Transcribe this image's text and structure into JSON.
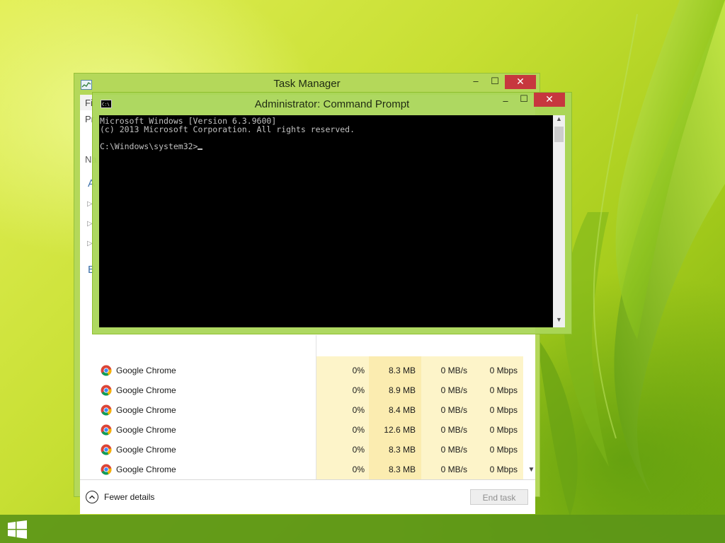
{
  "colors": {
    "accent": "#b4d85a",
    "close_button": "#c7373e",
    "console_bg": "#000000",
    "console_text": "#c0c0c0",
    "taskbar": "#5c9618",
    "column_highlight": "#fdf4c9"
  },
  "taskbar": {
    "start_icon": "windows-logo-icon"
  },
  "task_manager": {
    "title": "Task Manager",
    "icon": "task-manager-icon",
    "menu_peek": "Fi",
    "tab_peek": "Pr",
    "header_peek": "Na",
    "group_peek_apps": "A",
    "group_peek_background": "B",
    "processes": [
      {
        "name": "Google Chrome",
        "cpu": "0%",
        "memory": "8.3 MB",
        "disk": "0 MB/s",
        "network": "0 Mbps"
      },
      {
        "name": "Google Chrome",
        "cpu": "0%",
        "memory": "8.9 MB",
        "disk": "0 MB/s",
        "network": "0 Mbps"
      },
      {
        "name": "Google Chrome",
        "cpu": "0%",
        "memory": "8.4 MB",
        "disk": "0 MB/s",
        "network": "0 Mbps"
      },
      {
        "name": "Google Chrome",
        "cpu": "0%",
        "memory": "12.6 MB",
        "disk": "0 MB/s",
        "network": "0 Mbps"
      },
      {
        "name": "Google Chrome",
        "cpu": "0%",
        "memory": "8.3 MB",
        "disk": "0 MB/s",
        "network": "0 Mbps"
      },
      {
        "name": "Google Chrome",
        "cpu": "0%",
        "memory": "8.3 MB",
        "disk": "0 MB/s",
        "network": "0 Mbps"
      }
    ],
    "fewer_details_label": "Fewer details",
    "end_task_label": "End task"
  },
  "command_prompt": {
    "title": "Administrator:  Command Prompt",
    "icon": "console-icon",
    "lines": [
      "Microsoft Windows [Version 6.3.9600]",
      "(c) 2013 Microsoft Corporation. All rights reserved.",
      "",
      "C:\\Windows\\system32>"
    ]
  },
  "window_controls": {
    "minimize": "–",
    "maximize": "☐",
    "close": "✕"
  }
}
